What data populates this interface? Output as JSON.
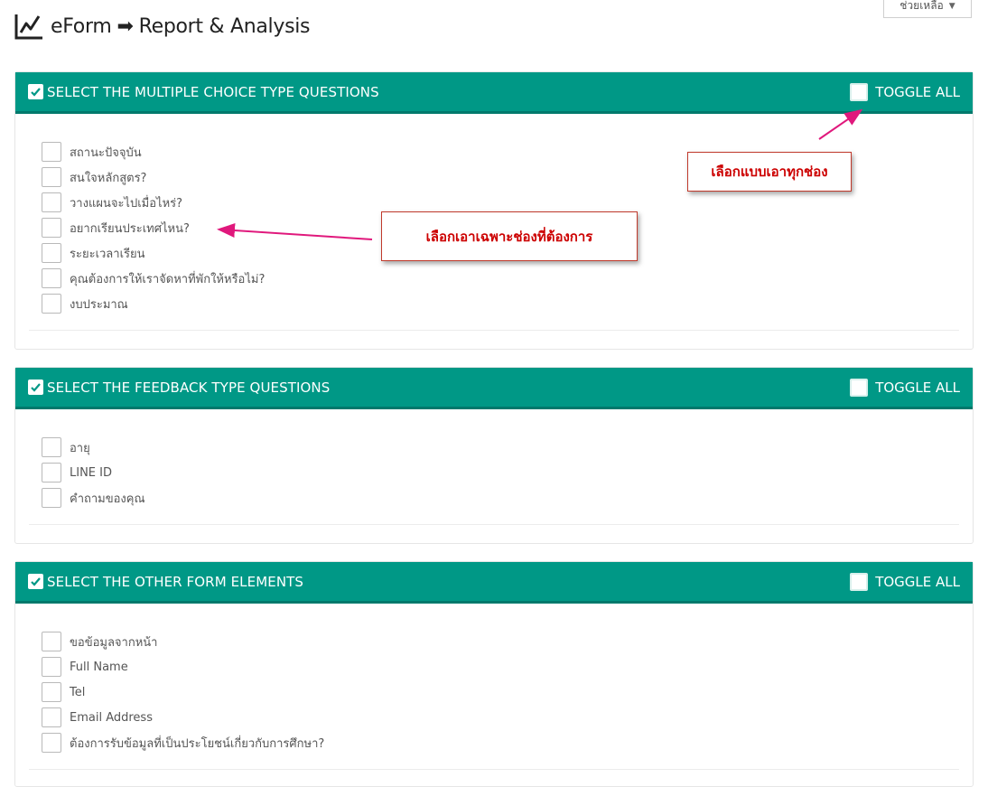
{
  "header": {
    "app": "eForm",
    "section": "Report & Analysis",
    "help_label": "ช่วยเหลือ"
  },
  "toggle_label": "TOGGLE ALL",
  "panels": [
    {
      "title": "SELECT THE MULTIPLE CHOICE TYPE QUESTIONS",
      "items": [
        "สถานะปัจจุบัน",
        "สนใจหลักสูตร?",
        "วางแผนจะไปเมื่อไหร่?",
        "อยากเรียนประเทศไหน?",
        "ระยะเวลาเรียน",
        "คุณต้องการให้เราจัดหาที่พักให้หรือไม่?",
        "งบประมาณ"
      ]
    },
    {
      "title": "SELECT THE FEEDBACK TYPE QUESTIONS",
      "items": [
        "อายุ",
        "LINE ID",
        "คำถามของคุณ"
      ]
    },
    {
      "title": "SELECT THE OTHER FORM ELEMENTS",
      "items": [
        "ขอข้อมูลจากหน้า",
        "Full Name",
        "Tel",
        "Email Address",
        "ต้องการรับข้อมูลที่เป็นประโยชน์เกี่ยวกับการศึกษา?"
      ]
    }
  ],
  "annotations": {
    "select_all": "เลือกแบบเอาทุกช่อง",
    "select_some": "เลือกเอาเฉพาะช่องที่ต้องการ"
  },
  "colors": {
    "panel_header": "#009886",
    "callout_text": "#cc0000",
    "arrow": "#e0187c"
  }
}
